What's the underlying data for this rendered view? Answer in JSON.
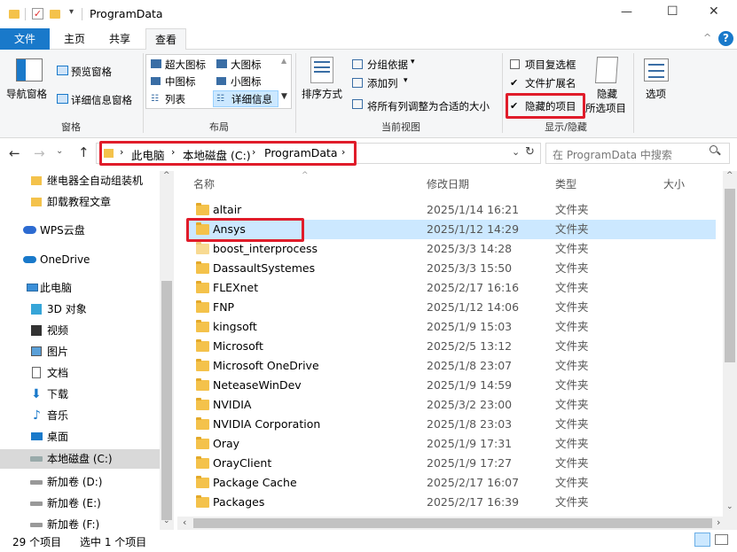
{
  "window": {
    "title": "ProgramData",
    "minimize": "—",
    "maximize": "☐",
    "close": "✕"
  },
  "tabs": [
    {
      "label": "文件",
      "active_style": "blue"
    },
    {
      "label": "主页"
    },
    {
      "label": "共享"
    },
    {
      "label": "查看",
      "active": true
    }
  ],
  "ribbon": {
    "panes": {
      "nav_pane": "导航窗格",
      "preview_pane": "预览窗格",
      "details_pane": "详细信息窗格",
      "group_label": "窗格"
    },
    "layout": {
      "xl_icons": "超大图标",
      "l_icons": "大图标",
      "m_icons": "中图标",
      "s_icons": "小图标",
      "list": "列表",
      "details": "详细信息",
      "group_label": "布局"
    },
    "current_view": {
      "sort": "排序方式",
      "group_by": "分组依据",
      "add_col": "添加列",
      "fit_cols": "将所有列调整为合适的大小",
      "group_label": "当前视图"
    },
    "show_hide": {
      "item_checkboxes": "项目复选框",
      "item_checkboxes_checked": false,
      "file_ext": "文件扩展名",
      "file_ext_checked": true,
      "hidden_items": "隐藏的项目",
      "hidden_items_checked": true,
      "hide_selected_1": "隐藏",
      "hide_selected_2": "所选项目",
      "group_label": "显示/隐藏"
    },
    "options": "选项"
  },
  "address": {
    "crumbs": [
      "此电脑",
      "本地磁盘 (C:)",
      "ProgramData"
    ],
    "search_placeholder": "在 ProgramData 中搜索"
  },
  "nav": [
    {
      "label": "继电器全自动组装机",
      "icon": "folder-icon"
    },
    {
      "label": "卸载教程文章",
      "icon": "folder-icon"
    },
    {
      "label": "WPS云盘",
      "icon": "cloud-icon"
    },
    {
      "label": "OneDrive",
      "icon": "onedrive-icon"
    },
    {
      "label": "此电脑",
      "icon": "pc-icon"
    },
    {
      "label": "3D 对象",
      "icon": "3d-icon"
    },
    {
      "label": "视频",
      "icon": "video-icon"
    },
    {
      "label": "图片",
      "icon": "pictures-icon"
    },
    {
      "label": "文档",
      "icon": "documents-icon"
    },
    {
      "label": "下载",
      "icon": "download-icon"
    },
    {
      "label": "音乐",
      "icon": "music-icon"
    },
    {
      "label": "桌面",
      "icon": "desktop-icon"
    },
    {
      "label": "本地磁盘 (C:)",
      "icon": "drive-icon",
      "selected": true
    },
    {
      "label": "新加卷 (D:)",
      "icon": "drive-icon"
    },
    {
      "label": "新加卷 (E:)",
      "icon": "drive-icon"
    },
    {
      "label": "新加卷 (F:)",
      "icon": "drive-icon"
    }
  ],
  "columns": [
    "名称",
    "修改日期",
    "类型",
    "大小"
  ],
  "files": [
    {
      "name": "altair",
      "date": "2025/1/14 16:21",
      "type": "文件夹"
    },
    {
      "name": "Ansys",
      "date": "2025/1/12 14:29",
      "type": "文件夹",
      "selected": true
    },
    {
      "name": "boost_interprocess",
      "date": "2025/3/3 14:28",
      "type": "文件夹",
      "hidden": true
    },
    {
      "name": "DassaultSystemes",
      "date": "2025/3/3 15:50",
      "type": "文件夹"
    },
    {
      "name": "FLEXnet",
      "date": "2025/2/17 16:16",
      "type": "文件夹"
    },
    {
      "name": "FNP",
      "date": "2025/1/12 14:06",
      "type": "文件夹"
    },
    {
      "name": "kingsoft",
      "date": "2025/1/9 15:03",
      "type": "文件夹"
    },
    {
      "name": "Microsoft",
      "date": "2025/2/5 13:12",
      "type": "文件夹"
    },
    {
      "name": "Microsoft OneDrive",
      "date": "2025/1/8 23:07",
      "type": "文件夹"
    },
    {
      "name": "NeteaseWinDev",
      "date": "2025/1/9 14:59",
      "type": "文件夹"
    },
    {
      "name": "NVIDIA",
      "date": "2025/3/2 23:00",
      "type": "文件夹"
    },
    {
      "name": "NVIDIA Corporation",
      "date": "2025/1/8 23:03",
      "type": "文件夹"
    },
    {
      "name": "Oray",
      "date": "2025/1/9 17:31",
      "type": "文件夹"
    },
    {
      "name": "OrayClient",
      "date": "2025/1/9 17:27",
      "type": "文件夹"
    },
    {
      "name": "Package Cache",
      "date": "2025/2/17 16:07",
      "type": "文件夹"
    },
    {
      "name": "Packages",
      "date": "2025/2/17 16:39",
      "type": "文件夹"
    }
  ],
  "status": {
    "item_count": "29 个项目",
    "selected": "选中 1 个项目"
  },
  "colors": {
    "accent": "#1979ca",
    "selection": "#cce8ff",
    "highlight_box": "#e01c2a",
    "folder": "#f4c24b"
  }
}
